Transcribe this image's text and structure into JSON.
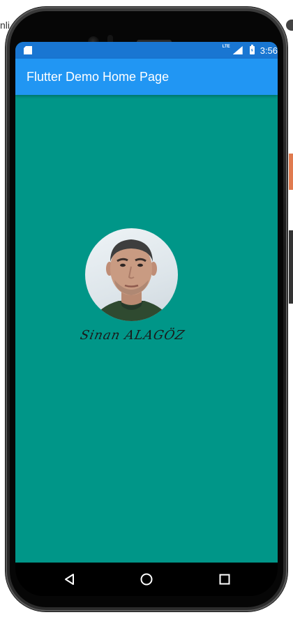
{
  "background": {
    "partial_text": "nli"
  },
  "status_bar": {
    "network_label": "LTE",
    "time": "3:56"
  },
  "app_bar": {
    "title": "Flutter Demo Home Page"
  },
  "profile": {
    "signature": "Sinan ALAGÖZ"
  },
  "colors": {
    "status_bar": "#1976d2",
    "app_bar": "#2196f3",
    "body": "#009688",
    "nav_bar": "#000000"
  },
  "nav": {
    "back_icon": "back-triangle-icon",
    "home_icon": "home-circle-icon",
    "recent_icon": "recents-square-icon"
  }
}
